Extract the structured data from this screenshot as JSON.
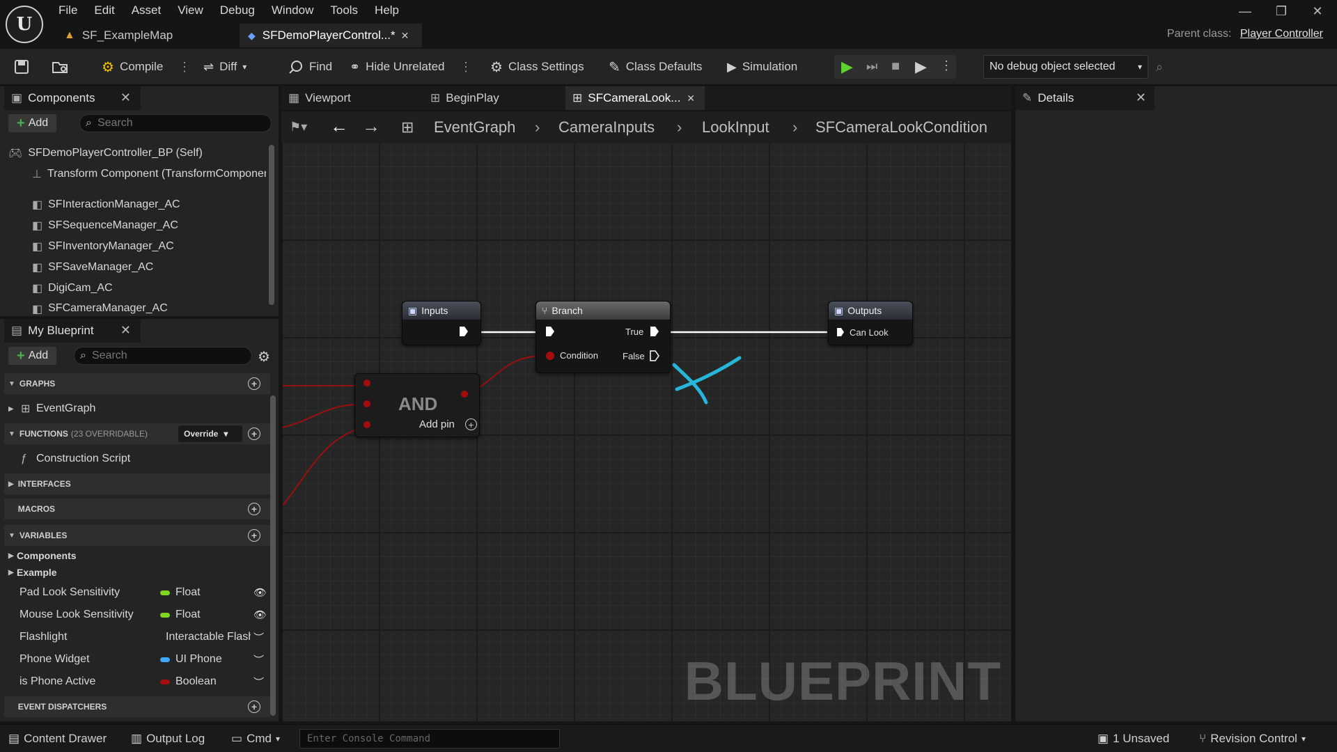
{
  "menu": [
    "File",
    "Edit",
    "Asset",
    "View",
    "Debug",
    "Window",
    "Tools",
    "Help"
  ],
  "doc_tabs": [
    {
      "label": "SF_ExampleMap"
    },
    {
      "label": "SFDemoPlayerControl...*"
    }
  ],
  "window_controls": {
    "minimize": "—",
    "restore": "❐",
    "close": "✕"
  },
  "parent_class": {
    "label": "Parent class:",
    "value": "Player Controller"
  },
  "toolbar": {
    "compile": "Compile",
    "diff": "Diff",
    "find": "Find",
    "hide_unrelated": "Hide Unrelated",
    "class_settings": "Class Settings",
    "class_defaults": "Class Defaults",
    "simulation": "Simulation",
    "debug_object": "No debug object selected"
  },
  "components_panel": {
    "title": "Components",
    "add_label": "Add",
    "search_placeholder": "Search",
    "items": [
      "SFDemoPlayerController_BP (Self)",
      "Transform Component (TransformComponent)",
      "SFInteractionManager_AC",
      "SFSequenceManager_AC",
      "SFInventoryManager_AC",
      "SFSaveManager_AC",
      "DigiCam_AC",
      "SFCameraManager_AC"
    ]
  },
  "my_blueprint": {
    "title": "My Blueprint",
    "add_label": "Add",
    "search_placeholder": "Search",
    "graphs_header": "GRAPHS",
    "graphs": [
      "EventGraph"
    ],
    "functions_header": "FUNCTIONS",
    "functions_sub": "(23 OVERRIDABLE)",
    "override_label": "Override",
    "functions": [
      "Construction Script"
    ],
    "interfaces_header": "INTERFACES",
    "macros_header": "MACROS",
    "variables_header": "VARIABLES",
    "var_groups": [
      "Components",
      "Example"
    ],
    "variables": [
      {
        "name": "Pad Look Sensitivity",
        "type": "Float",
        "color": "#7fd81f"
      },
      {
        "name": "Mouse Look Sensitivity",
        "type": "Float",
        "color": "#7fd81f"
      },
      {
        "name": "Flashlight",
        "type": "Interactable Flashlight",
        "color": "#2c62e0"
      },
      {
        "name": "Phone Widget",
        "type": "UI Phone",
        "color": "#3fa7ff"
      },
      {
        "name": "is Phone Active",
        "type": "Boolean",
        "color": "#a50d0d"
      }
    ],
    "event_dispatchers_header": "EVENT DISPATCHERS"
  },
  "graph_tabs": [
    "Viewport",
    "BeginPlay",
    "SFCameraLook..."
  ],
  "breadcrumb": [
    "EventGraph",
    "CameraInputs",
    "LookInput",
    "SFCameraLookCondition"
  ],
  "nodes": {
    "inputs": {
      "title": "Inputs"
    },
    "branch": {
      "title": "Branch",
      "pin_condition": "Condition",
      "pin_true": "True",
      "pin_false": "False"
    },
    "outputs": {
      "title": "Outputs",
      "pin_can_look": "Can Look"
    },
    "and": {
      "title": "AND",
      "add_pin": "Add pin"
    }
  },
  "watermark": "BLUEPRINT",
  "details_panel": {
    "title": "Details"
  },
  "bottom_bar": {
    "content_drawer": "Content Drawer",
    "output_log": "Output Log",
    "cmd": "Cmd",
    "console_placeholder": "Enter Console Command",
    "unsaved": "1 Unsaved",
    "revision_control": "Revision Control"
  },
  "colors": {
    "exec": "#ffffff",
    "bool_pin": "#a50d0d",
    "float_pin": "#7fd81f",
    "accent": "#3fa7ff",
    "play_green": "#5bd42e"
  }
}
